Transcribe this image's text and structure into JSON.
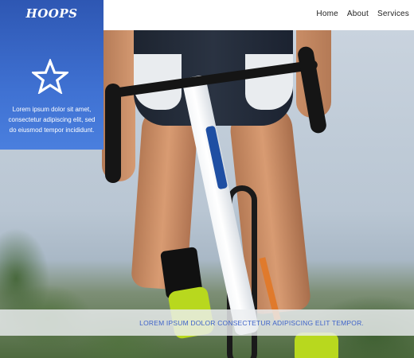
{
  "brand": {
    "title": "HOOPS",
    "icon": "star-outline-icon",
    "text": "Lorem ipsum dolor sit amet, consectetur adipiscing elit, sed do eiusmod tempor incididunt.",
    "panel_color": "#3f71d2"
  },
  "nav": {
    "items": [
      "Home",
      "About",
      "Services"
    ]
  },
  "hero": {
    "image": "cyclist-on-road-bike-photo"
  },
  "caption": {
    "text": "LOREM IPSUM DOLOR CONSECTETUR ADIPISCING ELIT TEMPOR.",
    "color": "#3f63c9"
  }
}
